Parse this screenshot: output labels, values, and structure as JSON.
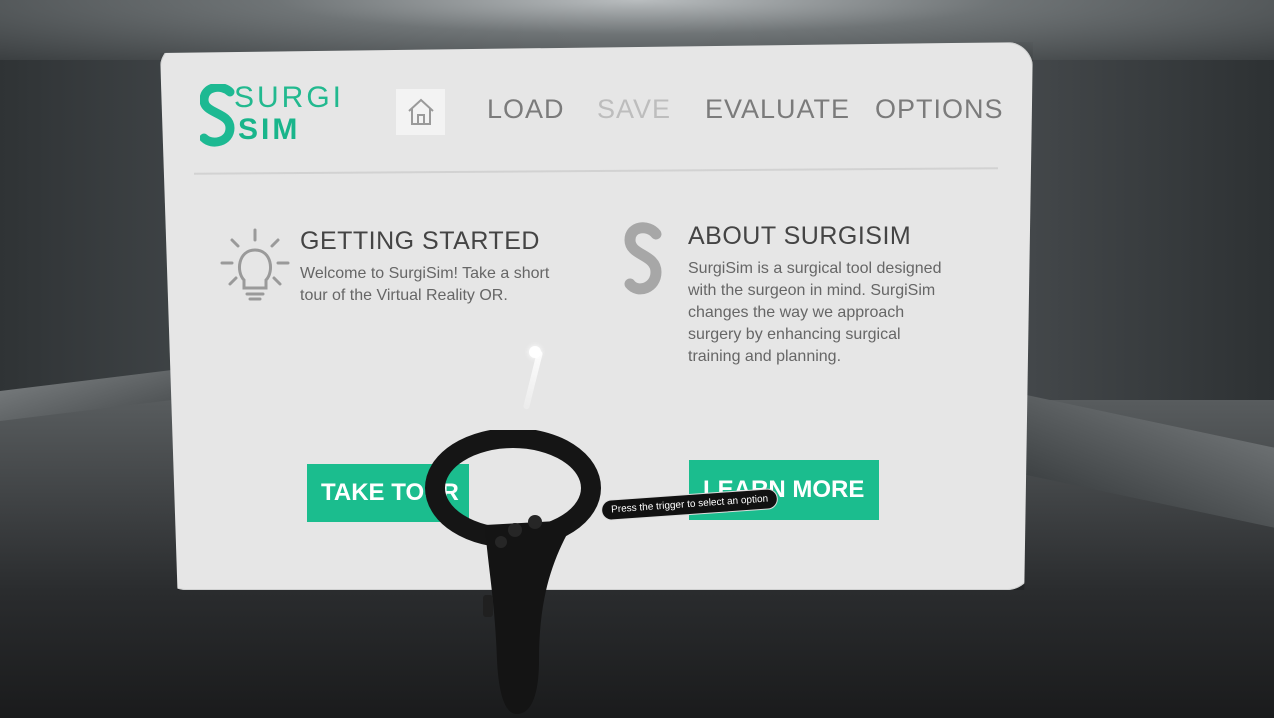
{
  "logo": {
    "line1": "SURGI",
    "line2": "SIM",
    "brand_color": "#1db992"
  },
  "nav": {
    "home_icon": "home-icon",
    "items": [
      {
        "label": "LOAD",
        "enabled": true
      },
      {
        "label": "SAVE",
        "enabled": false
      },
      {
        "label": "EVALUATE",
        "enabled": true
      },
      {
        "label": "OPTIONS",
        "enabled": true
      }
    ]
  },
  "getting_started": {
    "icon": "lightbulb-icon",
    "title": "GETTING STARTED",
    "line1": "Welcome to SurgiSim! Take a short",
    "line2": "tour of the Virtual Reality OR.",
    "button": "TAKE TOUR"
  },
  "about": {
    "icon": "surgisim-logo-icon",
    "title": "ABOUT SURGISIM",
    "line1": "SurgiSim is a surgical tool designed",
    "line2": "with the surgeon in mind. SurgiSim",
    "line3": "changes the way we approach",
    "line4": "surgery by enhancing surgical",
    "line5": "training and planning.",
    "button": "LEARN MORE"
  },
  "controller": {
    "icon": "vr-controller-icon",
    "tooltip": "Press the trigger to select an option"
  },
  "colors": {
    "accent": "#1bbd8e",
    "panel": "#e6e6e6",
    "text": "#444444"
  }
}
